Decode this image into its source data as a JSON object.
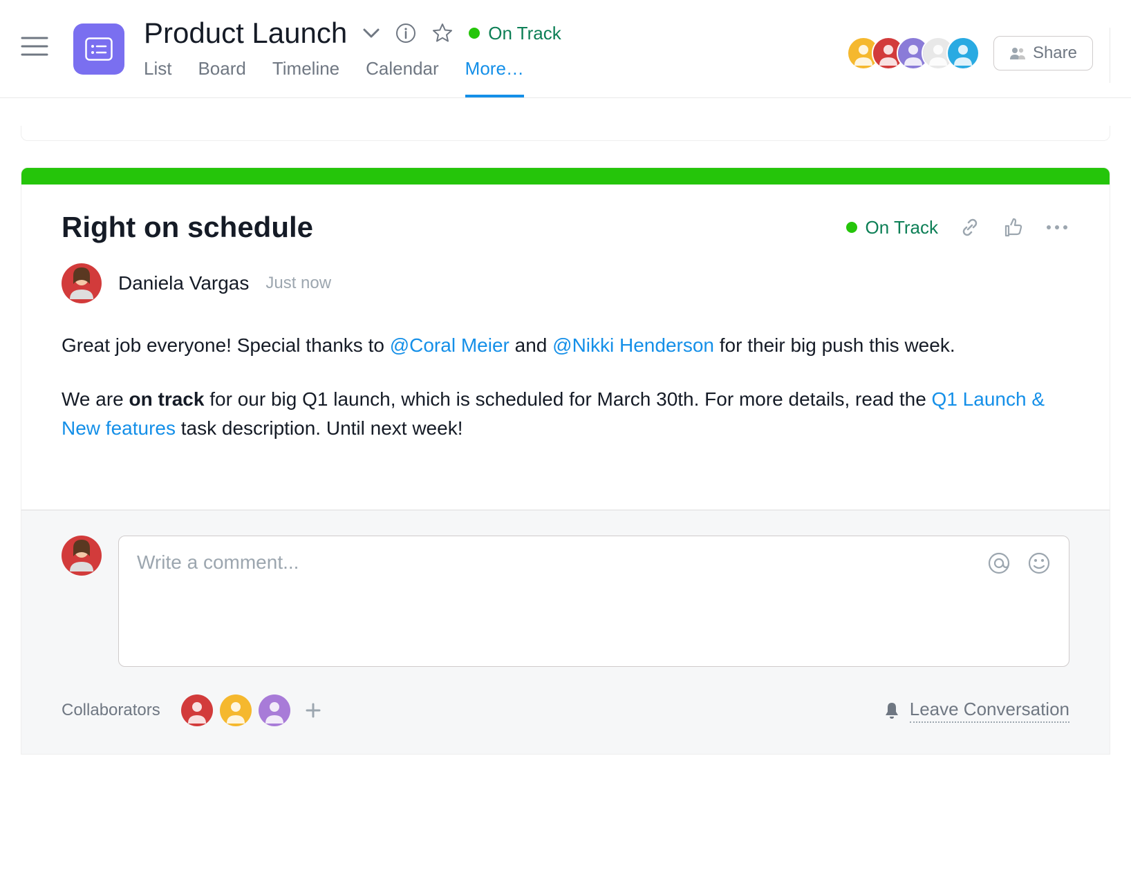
{
  "header": {
    "title": "Product Launch",
    "status": "On Track",
    "share_label": "Share",
    "tabs": [
      "List",
      "Board",
      "Timeline",
      "Calendar",
      "More…"
    ],
    "active_tab": 4,
    "avatar_colors": [
      "#f5b82e",
      "#d23b3b",
      "#8a7bd8",
      "#e8e8e8",
      "#29aae2"
    ]
  },
  "update": {
    "title": "Right on schedule",
    "status": "On Track",
    "author": "Daniela Vargas",
    "timestamp": "Just now",
    "body": {
      "p1_a": "Great job everyone! Special thanks to ",
      "mention1": "@Coral Meier",
      "p1_b": " and ",
      "mention2": "@Nikki Henderson",
      "p1_c": " for their big push this week.",
      "p2_a": "We are ",
      "bold": "on track",
      "p2_b": " for our big Q1 launch, which is scheduled for March 30th. For more details, read the ",
      "link": "Q1 Launch & New features",
      "p2_c": " task description. Until next week!"
    }
  },
  "comment": {
    "placeholder": "Write a comment..."
  },
  "footer": {
    "collaborators_label": "Collaborators",
    "collab_colors": [
      "#d23b3b",
      "#f5b82e",
      "#a87bd8"
    ],
    "leave_label": "Leave Conversation"
  }
}
